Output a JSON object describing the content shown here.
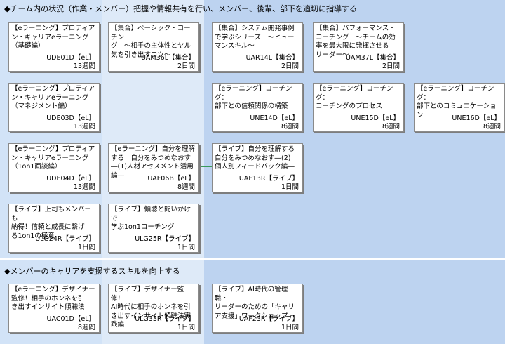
{
  "sections": [
    {
      "title": "◆チーム内の状況（作業・メンバー）把握や情報共有を行い、メンバー、後輩、部下を適切に指導する"
    },
    {
      "title": "◆メンバーのキャリアを支援するスキルを向上する"
    }
  ],
  "cards": [
    {
      "title": "【eラーニング】プロティア\nン・キャリアeラーニング\n（基礎編）",
      "code": "UDE01D【eL】",
      "duration": "13週間"
    },
    {
      "title": "【集合】ベーシック・コーチン\nグ　～相手の主体性とヤル\n気を引き出すコツ～",
      "code": "UAM36L【集合】",
      "duration": "2日間"
    },
    {
      "title": "【集合】システム開発事例\nで学ぶシリーズ　～ヒュー\nマンスキル～",
      "code": "UAR14L【集合】",
      "duration": "2日間"
    },
    {
      "title": "【集合】パフォーマンス・\nコーチング　～チームの効\n率を最大限に発揮させる\nリーダー～",
      "code": "UAM37L【集合】",
      "duration": "2日間"
    },
    {
      "title": "【eラーニング】プロティア\nン・キャリアeラーニング\n（マネジメント編）",
      "code": "UDE03D【eL】",
      "duration": "13週間"
    },
    {
      "title": "【eラーニング】コーチング：\n部下との信頼関係の構築",
      "code": "UNE14D【eL】",
      "duration": "8週間"
    },
    {
      "title": "【eラーニング】コーチング：\nコーチングのプロセス",
      "code": "UNE15D【eL】",
      "duration": "8週間"
    },
    {
      "title": "【eラーニング】コーチング：\n部下とのコミュニケーショ\nン",
      "code": "UNE16D【eL】",
      "duration": "8週間"
    },
    {
      "title": "【eラーニング】プロティア\nン・キャリアeラーニング\n（1on1面談編）",
      "code": "UDE04D【eL】",
      "duration": "13週間"
    },
    {
      "title": "【eラーニング】自分を理解\nする　自分をみつめなおす\n―(1)人材アセスメント活用\n編―",
      "code": "UAF06B【eL】",
      "duration": "8週間"
    },
    {
      "title": "【ライブ】自分を理解する\n自分をみつめなおす―(2)\n個人別フィードバック編―",
      "code": "UAF13R【ライブ】",
      "duration": "1日間"
    },
    {
      "title": "【ライブ】上司もメンバーも\n納得！信頼と成長に繋げ\nる1on1の極意",
      "code": "ULG24R【ライブ】",
      "duration": "1日間"
    },
    {
      "title": "【ライブ】傾聴と問いかけで\n学ぶ1on1コーチング",
      "code": "ULG25R【ライブ】",
      "duration": "1日間"
    },
    {
      "title": "【eラーニング】デザイナー\n監修！相手のホンネを引\nき出すインサイト傾聴法",
      "code": "UAC01D【eL】",
      "duration": "8週間"
    },
    {
      "title": "【ライブ】デザイナー監修！\nAI時代に相手のホンネを引\nき出すインサイト傾聴法実\n践編",
      "code": "ULG33R【ライブ】",
      "duration": "1日間"
    },
    {
      "title": "【ライブ】AI時代の管理職・\nリーダーのための「キャリ\nア支援」ワークショップ",
      "code": "UAF23R【ライブ】",
      "duration": "1日間"
    }
  ]
}
